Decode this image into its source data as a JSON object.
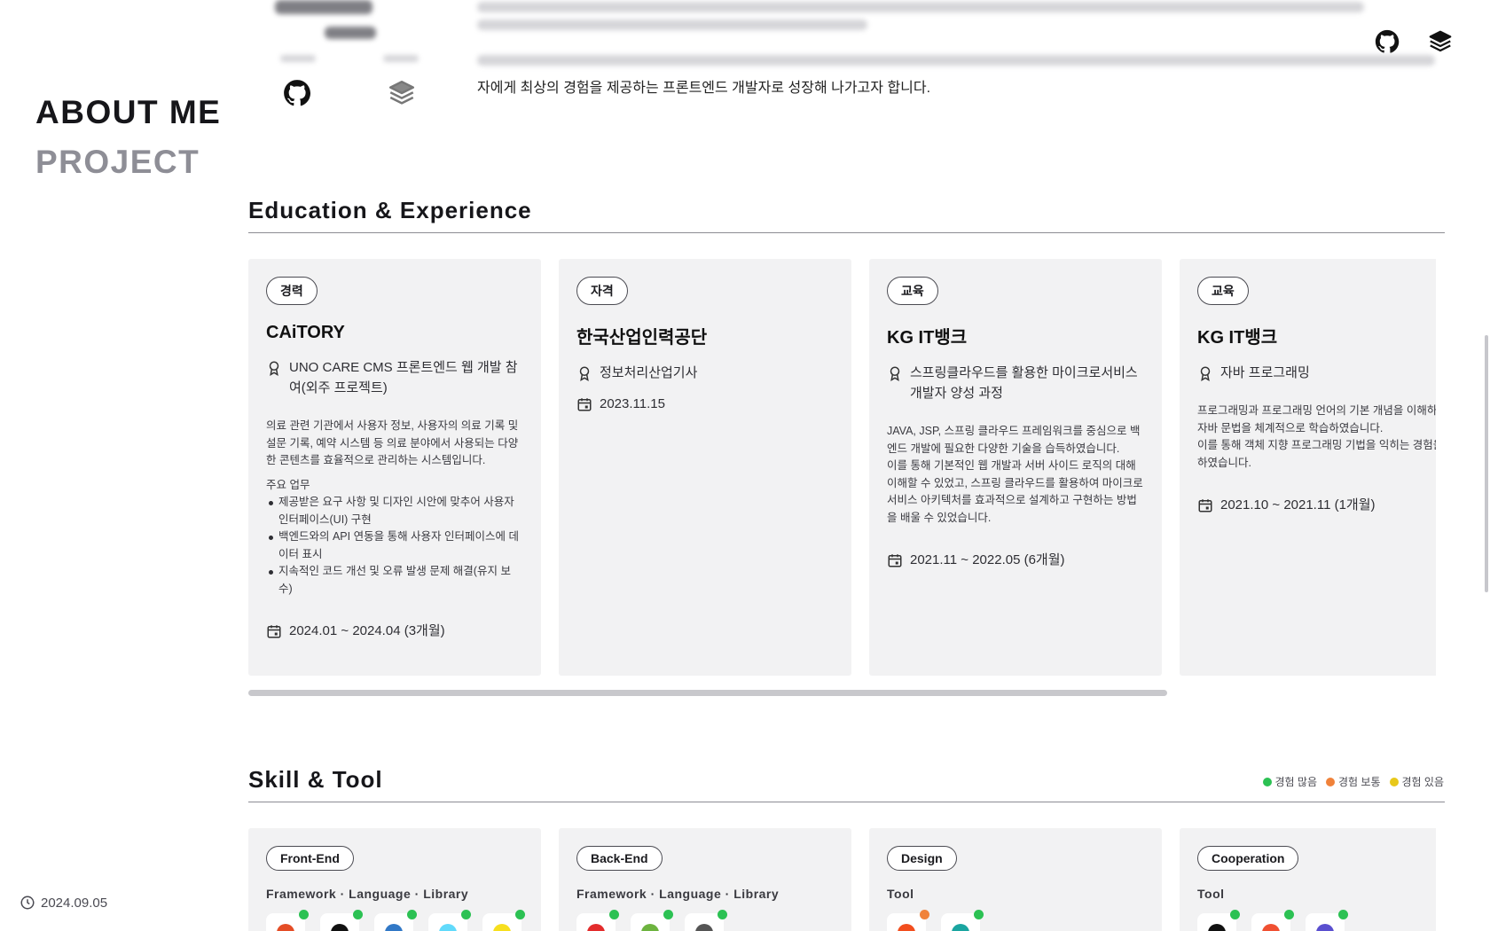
{
  "sidebar": {
    "nav": [
      {
        "label": "ABOUT ME",
        "active": true
      },
      {
        "label": "PROJECT",
        "active": false
      }
    ],
    "updated": "2024.09.05",
    "updated_icon": "clock-icon"
  },
  "header": {
    "links": [
      {
        "icon": "github-icon"
      },
      {
        "icon": "velog-icon"
      }
    ]
  },
  "intro": {
    "tail_text": "자에게 최상의 경험을 제공하는 프론트엔드 개발자로 성장해 나가고자 합니다.",
    "profile_links": [
      {
        "icon": "github-icon"
      },
      {
        "icon": "velog-icon"
      }
    ]
  },
  "education": {
    "title": "Education & Experience",
    "cards": [
      {
        "tag": "경력",
        "title": "CAiTORY",
        "role_icon": "award-icon",
        "role": "UNO CARE CMS 프론트엔드 웹 개발 참여(외주 프로젝트)",
        "desc": "의료 관련 기관에서 사용자 정보, 사용자의 의료 기록 및 설문 기록, 예약 시스템 등 의료 분야에서 사용되는 다양한 콘텐츠를 효율적으로 관리하는 시스템입니다.",
        "duties_head": "주요 업무",
        "duties": [
          "제공받은 요구 사항 및 디자인 시안에 맞추어 사용자 인터페이스(UI) 구현",
          "백엔드와의 API 연동을 통해 사용자 인터페이스에 데이터 표시",
          "지속적인 코드 개선 및 오류 발생 문제 해결(유지 보수)"
        ],
        "date_icon": "calendar-icon",
        "date": "2024.01 ~ 2024.04 (3개월)"
      },
      {
        "tag": "자격",
        "title": "한국산업인력공단",
        "role_icon": "award-icon",
        "role": "정보처리산업기사",
        "date_icon": "calendar-icon",
        "date": "2023.11.15"
      },
      {
        "tag": "교육",
        "title": "KG IT뱅크",
        "role_icon": "award-icon",
        "role": "스프링클라우드를 활용한 마이크로서비스 개발자 양성 과정",
        "desc": "JAVA, JSP, 스프링 클라우드 프레임워크를 중심으로 백엔드 개발에 필요한 다양한 기술을 습득하였습니다.",
        "desc2": "이를 통해 기본적인 웹 개발과 서버 사이드 로직의 대해 이해할 수 있었고, 스프링 클라우드를 활용하여 마이크로서비스 아키텍처를 효과적으로 설계하고 구현하는 방법을 배울 수 있었습니다.",
        "date_icon": "calendar-icon",
        "date": "2021.11 ~ 2022.05 (6개월)"
      },
      {
        "tag": "교육",
        "title": "KG IT뱅크",
        "role_icon": "award-icon",
        "role": "자바 프로그래밍",
        "desc": "프로그래밍과 프로그래밍 언어의 기본 개념을 이해하고, 자바 문법을 체계적으로 학습하였습니다.",
        "desc2": "이를 통해 객체 지향 프로그래밍 기법을 익히는 경험을 하였습니다.",
        "date_icon": "calendar-icon",
        "date": "2021.10 ~ 2021.11 (1개월)"
      }
    ]
  },
  "skills": {
    "title": "Skill & Tool",
    "legend": [
      {
        "label": "경험 많음",
        "color": "#2cc153"
      },
      {
        "label": "경험 보통",
        "color": "#f0823a"
      },
      {
        "label": "경험 있음",
        "color": "#e8c81a"
      }
    ],
    "cards": [
      {
        "tag": "Front-End",
        "sub": "Framework · Language · Library",
        "icons": [
          {
            "name": "skill-icon",
            "level": "#2cc153",
            "color": "#e44d26"
          },
          {
            "name": "skill-icon",
            "level": "#2cc153",
            "color": "#111111"
          },
          {
            "name": "skill-icon",
            "level": "#2cc153",
            "color": "#3178c6"
          },
          {
            "name": "skill-icon",
            "level": "#2cc153",
            "color": "#61dafb"
          },
          {
            "name": "skill-icon",
            "level": "#2cc153",
            "color": "#f7df1e"
          }
        ]
      },
      {
        "tag": "Back-End",
        "sub": "Framework · Language · Library",
        "icons": [
          {
            "name": "skill-icon",
            "level": "#2cc153",
            "color": "#e32c2c"
          },
          {
            "name": "skill-icon",
            "level": "#2cc153",
            "color": "#6db33f"
          },
          {
            "name": "skill-icon",
            "level": "#2cc153",
            "color": "#555555"
          }
        ]
      },
      {
        "tag": "Design",
        "sub": "Tool",
        "icons": [
          {
            "name": "skill-icon",
            "level": "#f0823a",
            "color": "#f24e1e"
          },
          {
            "name": "skill-icon",
            "level": "#2cc153",
            "color": "#1aa5a0"
          }
        ]
      },
      {
        "tag": "Cooperation",
        "sub": "Tool",
        "icons": [
          {
            "name": "skill-icon",
            "level": "#2cc153",
            "color": "#111111"
          },
          {
            "name": "skill-icon",
            "level": "#2cc153",
            "color": "#f05032"
          },
          {
            "name": "skill-icon",
            "level": "#2cc153",
            "color": "#5a4fcf"
          }
        ]
      }
    ]
  }
}
